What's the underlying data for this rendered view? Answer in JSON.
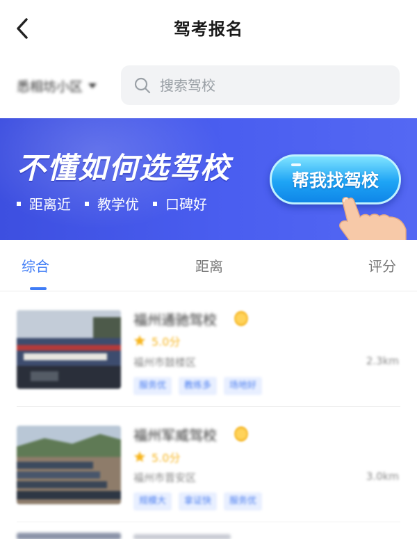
{
  "nav": {
    "back_icon": "chevron-left-icon",
    "title": "驾考报名"
  },
  "location": {
    "label": "悉相坊小区",
    "caret_icon": "caret-down-icon"
  },
  "search": {
    "icon": "search-icon",
    "placeholder": "搜索驾校"
  },
  "banner": {
    "headline": "不懂如何选驾校",
    "tags": [
      "距离近",
      "教学优",
      "口碑好"
    ],
    "cta_label": "帮我找驾校",
    "hand_icon": "pointing-hand-icon",
    "colors": {
      "background": "#4a5ef0",
      "cta": "#1ea4f5"
    }
  },
  "tabs": {
    "items": [
      "综合",
      "距离",
      "评分"
    ],
    "active_index": 0,
    "active_color": "#3f7cf6"
  },
  "schools": [
    {
      "name": "福州通驰驾校",
      "rating": "5.0分",
      "address": "福州市鼓楼区",
      "distance": "2.3km",
      "tags": [
        "服务优",
        "教练多",
        "场地好"
      ]
    },
    {
      "name": "福州军威驾校",
      "rating": "5.0分",
      "address": "福州市晋安区",
      "distance": "3.0km",
      "tags": [
        "规模大",
        "拿证快",
        "服务优"
      ]
    }
  ]
}
